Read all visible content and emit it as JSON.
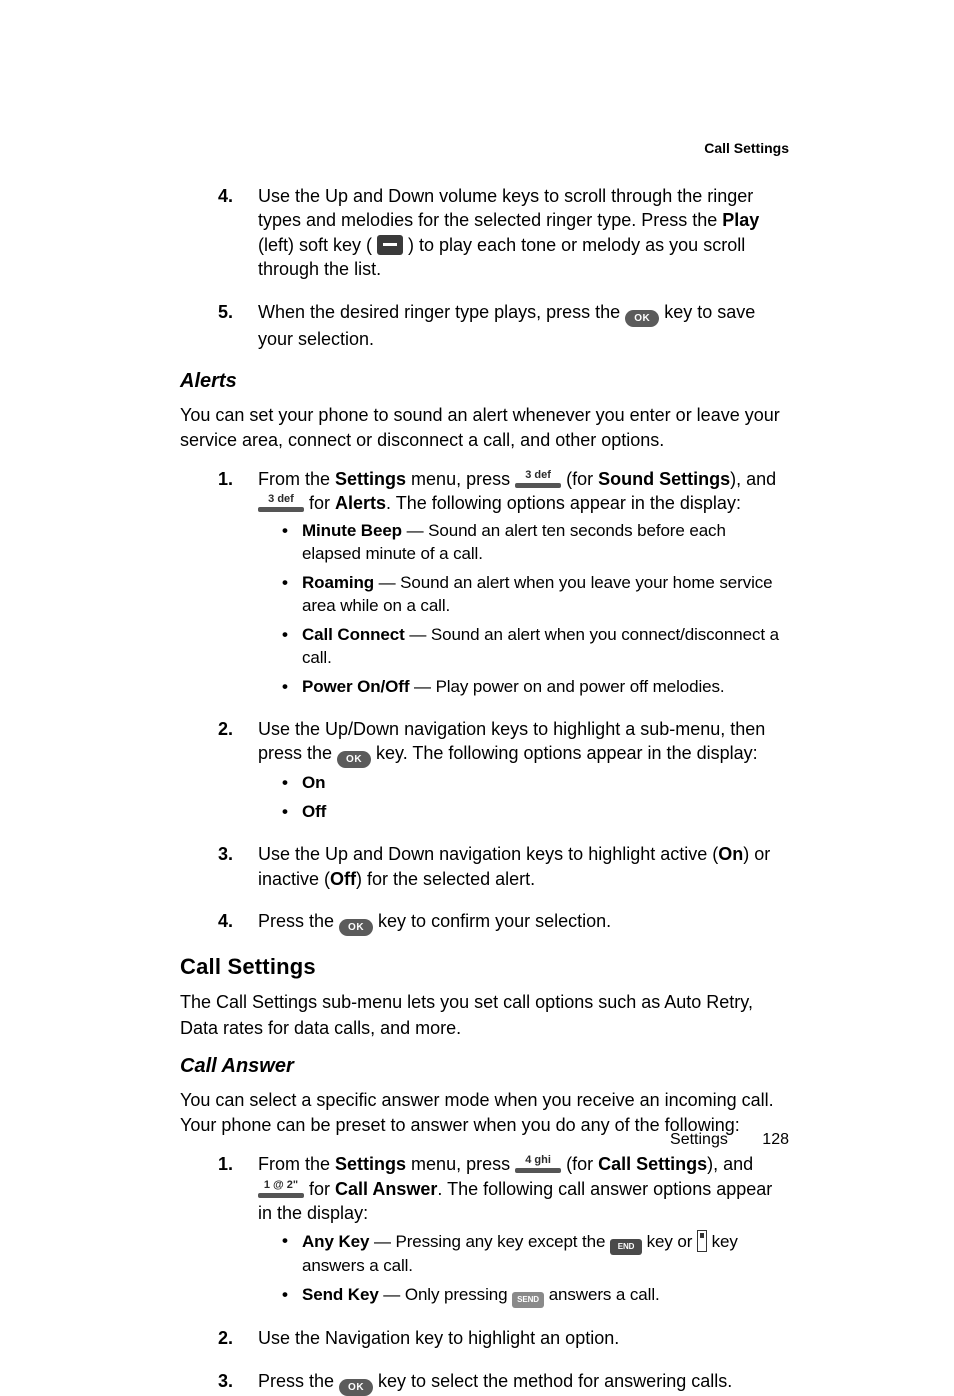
{
  "header": {
    "title": "Call Settings"
  },
  "top_steps": [
    {
      "num": "4.",
      "text_a": "Use the Up and Down volume keys to scroll through the ringer types and melodies for the selected ringer type. Press the ",
      "bold_a": "Play",
      "text_b": " (left) soft key ( ",
      "text_c": " ) to play each tone or melody as you scroll through the list."
    },
    {
      "num": "5.",
      "text_a": "When the desired ringer type plays, press the ",
      "text_b": " key to save your selection."
    }
  ],
  "alerts": {
    "heading": "Alerts",
    "intro": "You can set your phone to sound an alert whenever you enter or leave your service area, connect or disconnect a call, and other options.",
    "steps": [
      {
        "num": "1.",
        "a": "From the ",
        "b1": "Settings",
        "c": " menu, press ",
        "d": " (for ",
        "b2": "Sound Settings",
        "e": "), and ",
        "f": " for ",
        "b3": "Alerts",
        "g": ". The following options appear in the display:",
        "bullets": [
          {
            "b": "Minute Beep",
            "t": " — Sound an alert ten seconds before each elapsed minute of a call."
          },
          {
            "b": "Roaming",
            "t": " — Sound an alert when you leave your home service area while on a call."
          },
          {
            "b": "Call Connect",
            "t": " — Sound an alert when you connect/disconnect a call."
          },
          {
            "b": "Power On/Off",
            "t": " — Play power on and power off melodies."
          }
        ]
      },
      {
        "num": "2.",
        "a": "Use the Up/Down navigation keys to highlight a sub-menu, then press the ",
        "b": " key. The following options appear in the display:",
        "bullets2": [
          {
            "b": "On"
          },
          {
            "b": "Off"
          }
        ]
      },
      {
        "num": "3.",
        "a": "Use the Up and Down navigation keys to highlight active (",
        "b1": "On",
        "b": ") or inactive (",
        "b2": "Off",
        "c": ") for the selected alert."
      },
      {
        "num": "4.",
        "a": "Press the ",
        "b": " key to confirm your selection."
      }
    ]
  },
  "callsettings": {
    "heading": "Call Settings",
    "intro": "The Call Settings sub-menu lets you set call options such as Auto Retry, Data rates for data calls, and more."
  },
  "callanswer": {
    "heading": "Call Answer",
    "intro": "You can select a specific answer mode when you receive an incoming call. Your phone can be preset to answer when you do any of the following:",
    "steps": [
      {
        "num": "1.",
        "a": "From the ",
        "b1": "Settings",
        "b": " menu, press ",
        "c": " (for ",
        "b2": "Call Settings",
        "d": "), and ",
        "e": " for ",
        "b3": "Call Answer",
        "f": ". The following call answer options appear in the display:",
        "bullets": [
          {
            "b": "Any Key",
            "t1": " — Pressing any key except the ",
            "t2": " key or ",
            "t3": " key answers a call."
          },
          {
            "b": "Send Key",
            "t1": " — Only pressing ",
            "t2": " answers a call."
          }
        ]
      },
      {
        "num": "2.",
        "a": "Use the Navigation key to highlight an option."
      },
      {
        "num": "3.",
        "a": "Press the ",
        "b": " key to select the method for answering calls."
      }
    ]
  },
  "keylabels": {
    "three": "3 def",
    "four": "4 ghi",
    "one": "1 @ 2\""
  },
  "footer": {
    "section": "Settings",
    "page": "128"
  }
}
